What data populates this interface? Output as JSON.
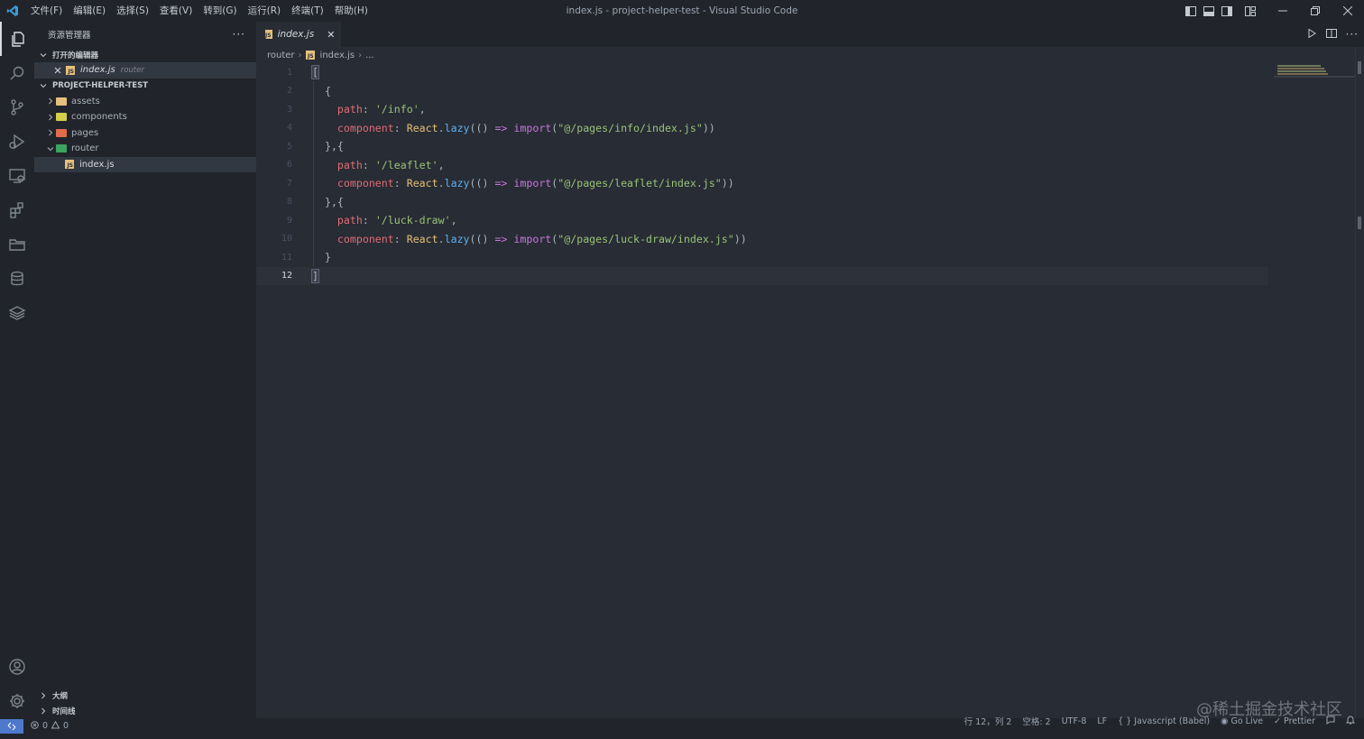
{
  "window": {
    "title": "index.js - project-helper-test - Visual Studio Code",
    "menu": [
      "文件(F)",
      "编辑(E)",
      "选择(S)",
      "查看(V)",
      "转到(G)",
      "运行(R)",
      "终端(T)",
      "帮助(H)"
    ]
  },
  "sidebar": {
    "title": "资源管理器",
    "more": "···",
    "open_editors": {
      "label": "打开的编辑器",
      "file": "index.js",
      "file_desc": "router"
    },
    "project": {
      "label": "PROJECT-HELPER-TEST",
      "items": [
        {
          "name": "assets",
          "color": "#e5c07b"
        },
        {
          "name": "components",
          "color": "#d4d04a"
        },
        {
          "name": "pages",
          "color": "#e06c4b"
        },
        {
          "name": "router",
          "color": "#3ca45c"
        }
      ],
      "child": "index.js"
    },
    "outline": "大纲",
    "timeline": "时间线"
  },
  "tab": {
    "name": "index.js",
    "close": "✕"
  },
  "breadcrumb": {
    "folder": "router",
    "file": "index.js",
    "rest": "..."
  },
  "editor": {
    "line_numbers": [
      "1",
      "2",
      "3",
      "4",
      "5",
      "6",
      "7",
      "8",
      "9",
      "10",
      "11",
      "12"
    ],
    "current_line": 12,
    "lines": [
      {
        "bracket": "["
      },
      {
        "open": "{"
      },
      {
        "prop": "path",
        "str": "'/info'",
        "end": ","
      },
      {
        "prop": "component",
        "cls": "React",
        "fn": "lazy",
        "arrow": "=>",
        "kw": "import",
        "path": "\"@/pages/info/index.js\""
      },
      {
        "close": "},{"
      },
      {
        "prop": "path",
        "str": "'/leaflet'",
        "end": ","
      },
      {
        "prop": "component",
        "cls": "React",
        "fn": "lazy",
        "arrow": "=>",
        "kw": "import",
        "path": "\"@/pages/leaflet/index.js\""
      },
      {
        "close": "},{"
      },
      {
        "prop": "path",
        "str": "'/luck-draw'",
        "end": ","
      },
      {
        "prop": "component",
        "cls": "React",
        "fn": "lazy",
        "arrow": "=>",
        "kw": "import",
        "path": "\"@/pages/luck-draw/index.js\""
      },
      {
        "close": "}"
      },
      {
        "bracket": "]"
      }
    ]
  },
  "statusbar": {
    "errors": "0",
    "warnings": "0",
    "position": "行 12，列 2",
    "spaces": "空格: 2",
    "encoding": "UTF-8",
    "eol": "LF",
    "language": "Javascript (Babel)",
    "golive": "Go Live",
    "prettier": "Prettier"
  },
  "watermark": "@稀土掘金技术社区",
  "colors": {
    "editor_bg": "#282c34",
    "sidebar_bg": "#21252b",
    "remote_bg": "#4d78cc"
  }
}
